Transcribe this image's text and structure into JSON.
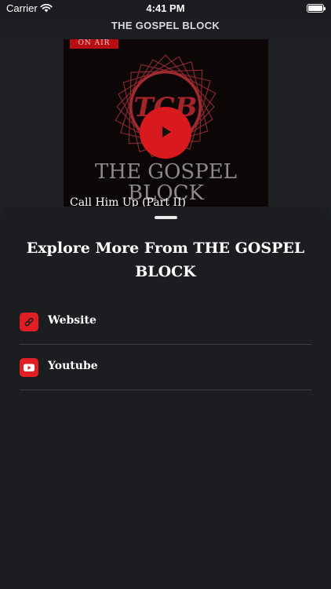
{
  "status_bar": {
    "carrier": "Carrier",
    "time": "4:41 PM"
  },
  "nav": {
    "title": "THE GOSPEL BLOCK"
  },
  "player": {
    "badge": "ON AIR",
    "logo_text": "TCB",
    "brand_line1": "THE GOSPEL",
    "brand_line2": "BLOCK",
    "track_title": "Call Him Up (Part II)"
  },
  "sheet": {
    "title": "Explore More From THE GOSPEL BLOCK",
    "links": [
      {
        "label": "Website",
        "icon": "link-icon"
      },
      {
        "label": "Youtube",
        "icon": "youtube-icon"
      }
    ]
  },
  "colors": {
    "accent": "#e01e24",
    "sheet_bg": "#1b1d20",
    "divider": "#3a3c40"
  }
}
